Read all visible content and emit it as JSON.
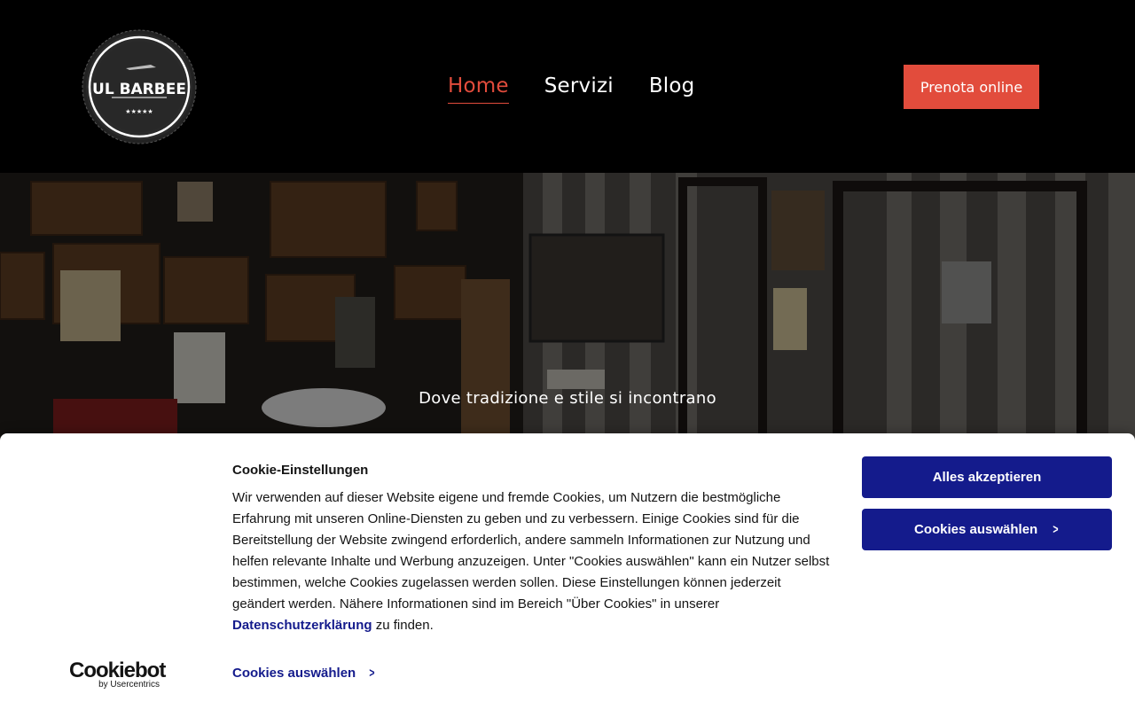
{
  "header": {
    "logo_text": "UL BARBEE",
    "logo_stars": "★★★★★",
    "nav": [
      {
        "label": "Home",
        "active": true
      },
      {
        "label": "Servizi",
        "active": false
      },
      {
        "label": "Blog",
        "active": false
      }
    ],
    "cta_label": "Prenota online"
  },
  "hero": {
    "tagline": "Dove tradizione e stile si incontrano"
  },
  "cookie_banner": {
    "title": "Cookie-Einstellungen",
    "text_before_link": "Wir verwenden auf dieser Website eigene und fremde Cookies, um Nutzern die bestmögliche Erfahrung mit unseren Online-Diensten zu geben und zu verbessern. Einige Cookies sind für die Bereitstellung der Website zwingend erforderlich, andere sammeln Informationen zur Nutzung und helfen relevante Inhalte und Werbung anzuzeigen. Unter \"Cookies auswählen\" kann ein Nutzer selbst bestimmen, welche Cookies zugelassen werden sollen. Diese Einstellungen können jederzeit geändert werden. Nähere Informationen sind im Bereich \"Über Cookies\" in unserer ",
    "link_text": "Datenschutzerklärung",
    "text_after_link": " zu finden.",
    "select_link_label": "Cookies auswählen",
    "accept_button": "Alles akzeptieren",
    "select_button": "Cookies auswählen",
    "brand": "Cookiebot",
    "brand_sub": "by Usercentrics"
  },
  "colors": {
    "accent": "#e24c3c",
    "cookie_primary": "#141b8c",
    "header_bg": "#000000"
  }
}
